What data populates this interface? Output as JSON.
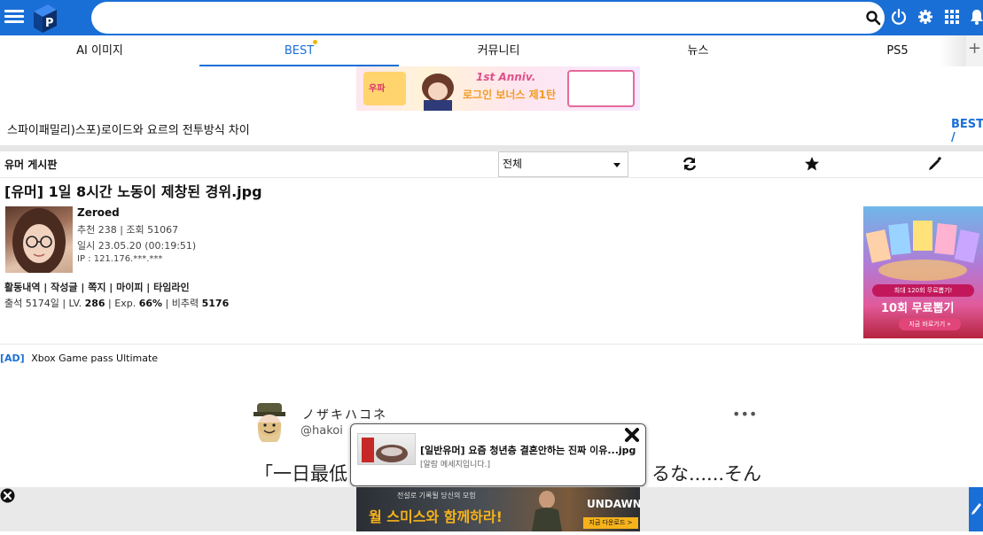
{
  "header": {
    "search_placeholder": "",
    "search_value": ""
  },
  "tabs": [
    {
      "label": "AI 이미지"
    },
    {
      "label": "BEST"
    },
    {
      "label": "커뮤니티"
    },
    {
      "label": "뉴스"
    },
    {
      "label": "PS5"
    }
  ],
  "tabs_plus": "+",
  "top_banner": {
    "left_text": "우파",
    "main_text": "1st Anniv.",
    "sub_text": "로그인 보너스 제1탄"
  },
  "notice": {
    "text": "스파이패밀리)스포)로이드와 요르의 전투방식 차이",
    "best_label": "BEST /"
  },
  "board": {
    "title": "유머 게시판",
    "filter": "전체"
  },
  "post": {
    "title": "[유머] 1일 8시간 노동이 제창된 경위.jpg",
    "author": "Zeroed",
    "recommend_views": "추천 238 | 조회 51067",
    "datetime": "일시 23.05.20 (00:19:51)",
    "ip": "IP : 121.176.***.***",
    "links": "활동내역 | 작성글 | 쪽지 | 마이피 | 타임라인",
    "attendance": "출석 5174일 |  LV.",
    "level": "286",
    "exp_label": " | Exp.",
    "exp": "66%",
    "tax_label": " | 비추력",
    "tax": "5176"
  },
  "side_ad": {
    "badge": "최대 120회 무료뽑기!",
    "headline": "10회 무료뽑기",
    "button": "지금 바로가기 »"
  },
  "ad_line": {
    "tag": "[AD]",
    "text": "Xbox Game pass Ultimate"
  },
  "tweet": {
    "name": "ノザキハコネ",
    "handle": "@hakoi",
    "more": "•••",
    "text": "「一日最低",
    "text_right": "るな......そん"
  },
  "popup": {
    "title": "[일반유머] 요즘 청년층 결혼안하는 진짜 이유...jpg",
    "subtitle": "[알람 메세지입니다.]"
  },
  "bottom_ad": {
    "tagline": "전설로 기록될 당신의 모험",
    "headline": "월 스미스와 함께하라!",
    "brand": "UNDAWN",
    "button": "지금 다운로드 >"
  },
  "colors": {
    "brand_blue": "#1a6fd6",
    "tab_dot": "#f4b400"
  }
}
